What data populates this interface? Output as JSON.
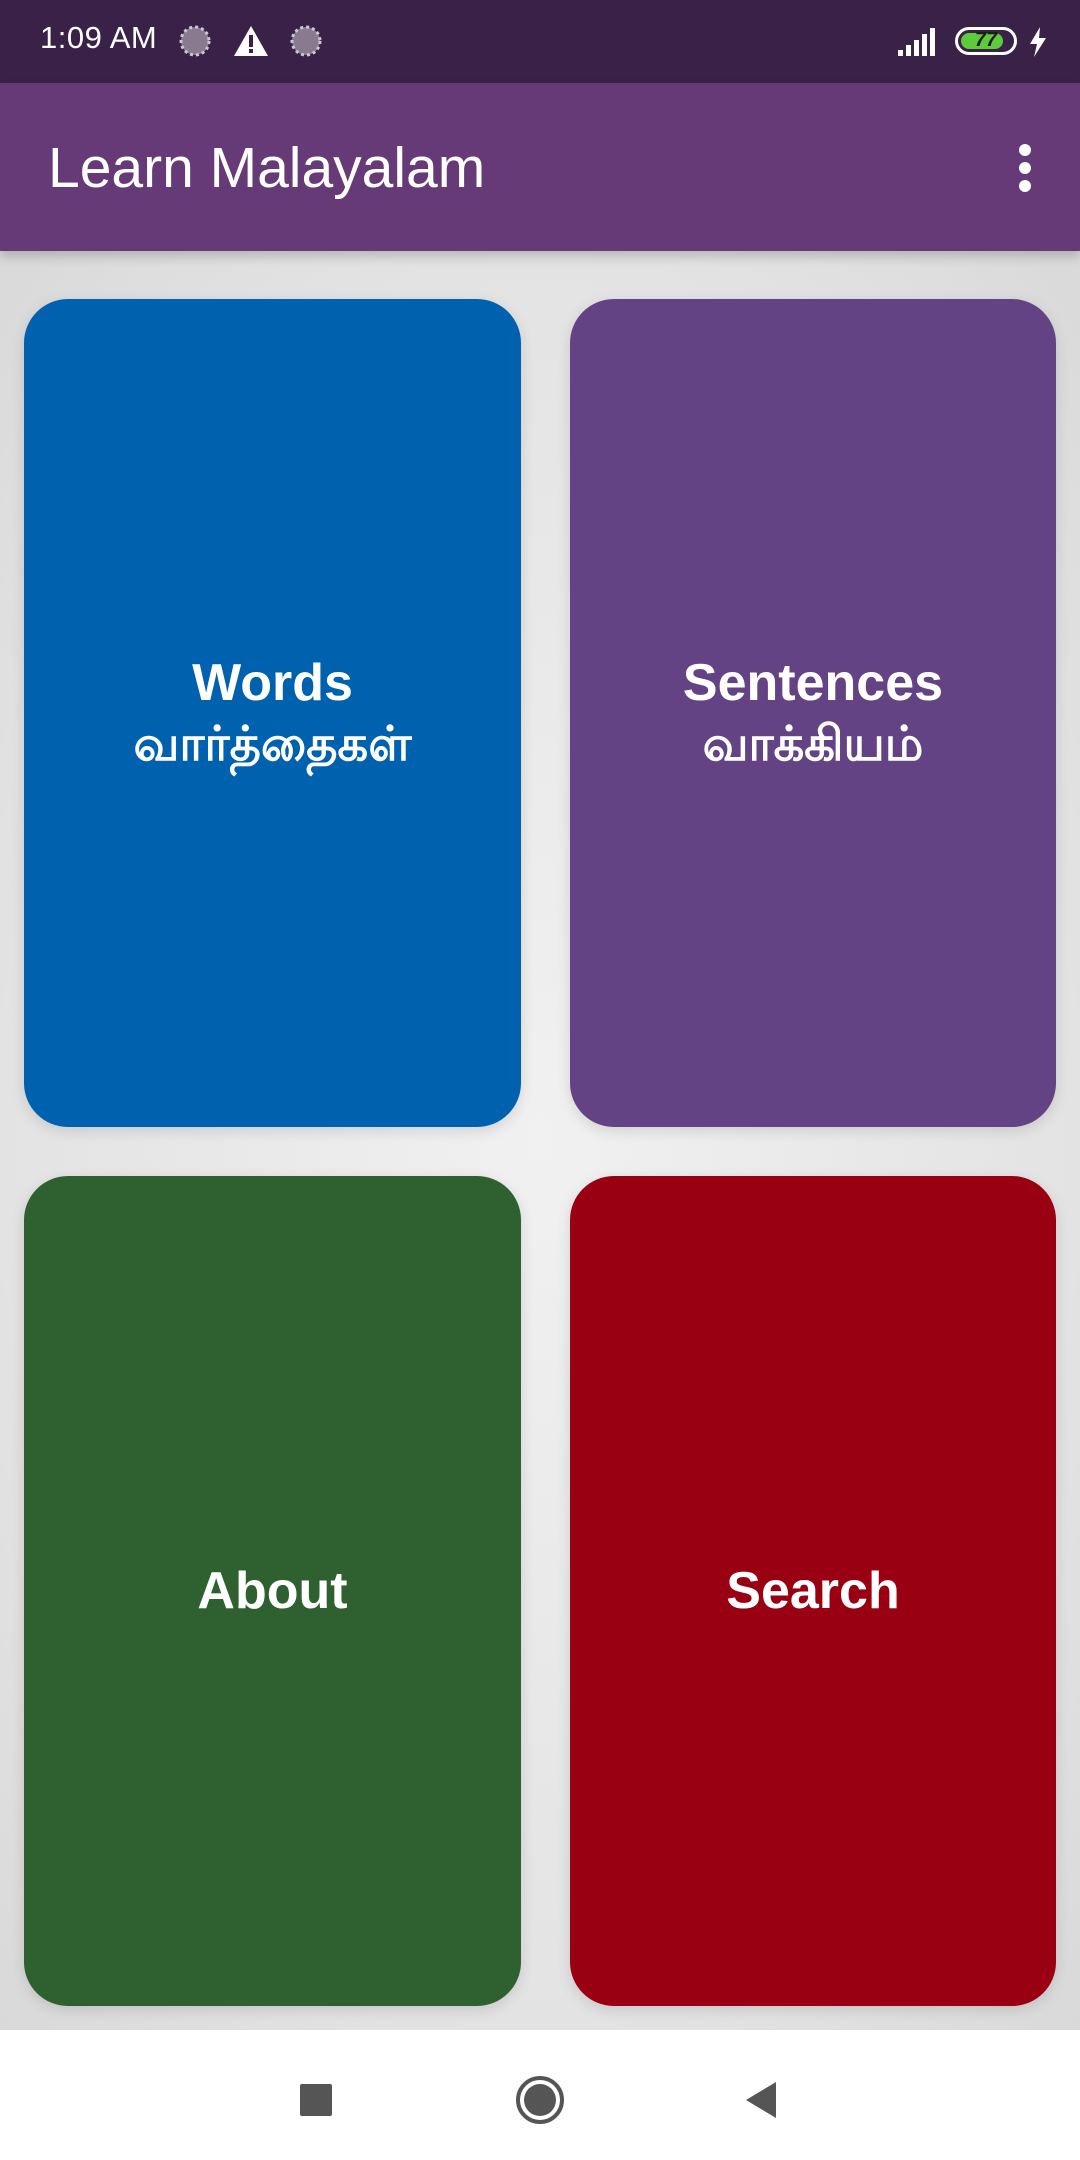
{
  "status_bar": {
    "time": "1:09 AM",
    "battery_level": "77",
    "icons": [
      "loading-circle-icon",
      "warning-icon",
      "loading-circle-icon",
      "signal-icon",
      "battery-icon",
      "charging-icon"
    ]
  },
  "app_bar": {
    "title": "Learn Malayalam",
    "menu_icon": "more-vert-icon"
  },
  "tiles": [
    {
      "title": "Words",
      "subtitle": "வார்த்தைகள்",
      "color": "#0061ae"
    },
    {
      "title": "Sentences",
      "subtitle": "வாக்கியம்",
      "color": "#634384"
    },
    {
      "title": "About",
      "subtitle": "",
      "color": "#2f602f"
    },
    {
      "title": "Search",
      "subtitle": "",
      "color": "#990011"
    }
  ],
  "nav_bar": {
    "recents_icon": "square-icon",
    "home_icon": "circle-icon",
    "back_icon": "triangle-back-icon"
  }
}
